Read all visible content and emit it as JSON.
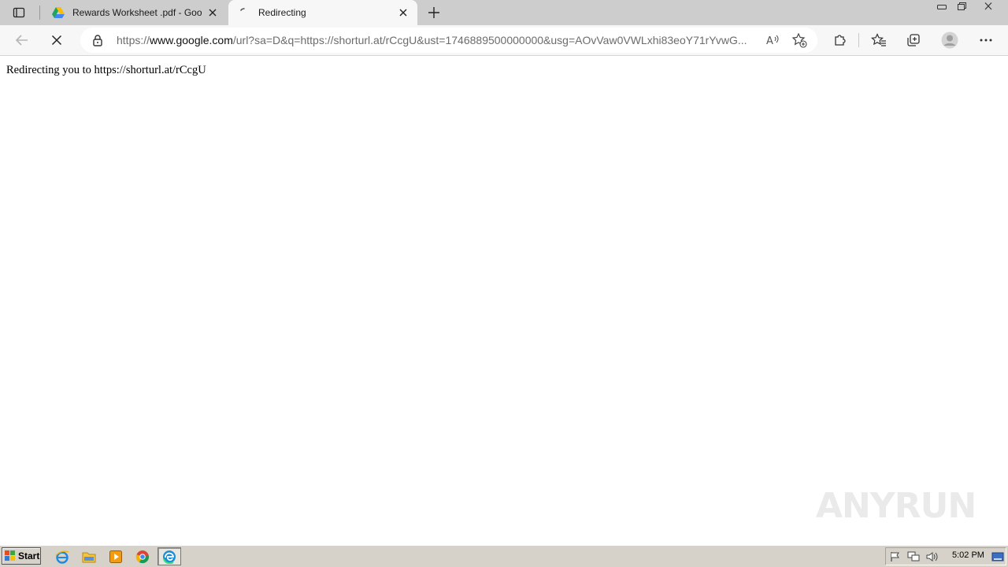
{
  "tabs": [
    {
      "title": "Rewards Worksheet .pdf - Goog",
      "favicon": "google-drive-icon",
      "active": false
    },
    {
      "title": "Redirecting",
      "favicon": "loading-spinner-icon",
      "active": true
    }
  ],
  "address_bar": {
    "scheme": "https://",
    "host": "www.google.com",
    "path": "/url?sa=D&q=https://shorturl.at/rCcgU&ust=1746889500000000&usg=AOvVaw0VWLxhi83eoY71rYvwG..."
  },
  "page": {
    "text": "Redirecting you to https://shorturl.at/rCcgU"
  },
  "watermark": {
    "left": "ANY",
    "right": "RUN"
  },
  "taskbar": {
    "start_label": "Start",
    "clock": "5:02 PM"
  },
  "colors": {
    "tabstrip": "#cdcdcd",
    "toolbar": "#f7f7f7",
    "taskbar": "#d6d2c9"
  }
}
